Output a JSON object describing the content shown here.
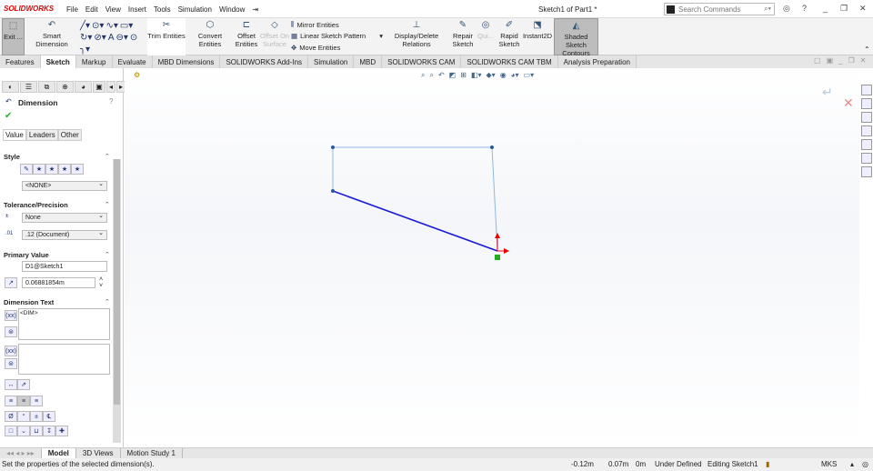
{
  "app": {
    "logo": "SOLIDWORKS",
    "title": "Sketch1 of Part1 *",
    "search_placeholder": "Search Commands"
  },
  "menu": [
    "File",
    "Edit",
    "View",
    "Insert",
    "Tools",
    "Simulation",
    "Window"
  ],
  "ribbon": {
    "exit": "Exit ...",
    "smart_dimension": "Smart Dimension",
    "trim": "Trim Entities",
    "convert": "Convert Entities",
    "offset": "Offset Entities",
    "offset_surface": "Offset On Surface",
    "mirror": "Mirror Entities",
    "linear_pattern": "Linear Sketch Pattern",
    "move": "Move Entities",
    "display_relations": "Display/Delete Relations",
    "repair": "Repair Sketch",
    "quick": "Qui...",
    "rapid": "Rapid Sketch",
    "instant2d": "Instant2D",
    "shaded": "Shaded Sketch Contours"
  },
  "tabs": [
    "Features",
    "Sketch",
    "Markup",
    "Evaluate",
    "MBD Dimensions",
    "SOLIDWORKS Add-Ins",
    "Simulation",
    "MBD",
    "SOLIDWORKS CAM",
    "SOLIDWORKS CAM TBM",
    "Analysis Preparation"
  ],
  "active_tab": "Sketch",
  "panel": {
    "title": "Dimension",
    "tabs": [
      "Value",
      "Leaders",
      "Other"
    ],
    "style_label": "Style",
    "style_value": "<NONE>",
    "tolerance_label": "Tolerance/Precision",
    "tolerance_value": "None",
    "precision_value": ".12 (Document)",
    "primary_label": "Primary Value",
    "primary_name": "D1@Sketch1",
    "primary_value": "0.06881854m",
    "dimtext_label": "Dimension Text",
    "dimtext_value": "<DIM>"
  },
  "bottom_tabs": [
    "Model",
    "3D Views",
    "Motion Study 1"
  ],
  "status": {
    "message": "Set the properties of the selected dimension(s).",
    "x": "-0.12m",
    "y": "0.07m",
    "z": "0m",
    "state": "Under Defined",
    "editing": "Editing Sketch1",
    "units": "MKS"
  },
  "colors": {
    "sketch_line": "#1a1adb",
    "construction": "#8fb8e0",
    "selected_tool": "#bdbdbd"
  }
}
